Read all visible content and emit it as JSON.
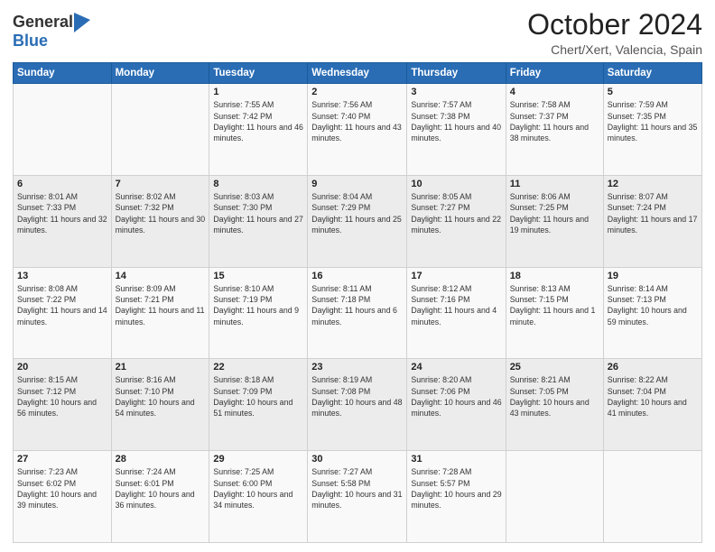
{
  "logo": {
    "general": "General",
    "blue": "Blue"
  },
  "header": {
    "month": "October 2024",
    "location": "Chert/Xert, Valencia, Spain"
  },
  "weekdays": [
    "Sunday",
    "Monday",
    "Tuesday",
    "Wednesday",
    "Thursday",
    "Friday",
    "Saturday"
  ],
  "weeks": [
    [
      {
        "day": "",
        "info": ""
      },
      {
        "day": "",
        "info": ""
      },
      {
        "day": "1",
        "info": "Sunrise: 7:55 AM\nSunset: 7:42 PM\nDaylight: 11 hours and 46 minutes."
      },
      {
        "day": "2",
        "info": "Sunrise: 7:56 AM\nSunset: 7:40 PM\nDaylight: 11 hours and 43 minutes."
      },
      {
        "day": "3",
        "info": "Sunrise: 7:57 AM\nSunset: 7:38 PM\nDaylight: 11 hours and 40 minutes."
      },
      {
        "day": "4",
        "info": "Sunrise: 7:58 AM\nSunset: 7:37 PM\nDaylight: 11 hours and 38 minutes."
      },
      {
        "day": "5",
        "info": "Sunrise: 7:59 AM\nSunset: 7:35 PM\nDaylight: 11 hours and 35 minutes."
      }
    ],
    [
      {
        "day": "6",
        "info": "Sunrise: 8:01 AM\nSunset: 7:33 PM\nDaylight: 11 hours and 32 minutes."
      },
      {
        "day": "7",
        "info": "Sunrise: 8:02 AM\nSunset: 7:32 PM\nDaylight: 11 hours and 30 minutes."
      },
      {
        "day": "8",
        "info": "Sunrise: 8:03 AM\nSunset: 7:30 PM\nDaylight: 11 hours and 27 minutes."
      },
      {
        "day": "9",
        "info": "Sunrise: 8:04 AM\nSunset: 7:29 PM\nDaylight: 11 hours and 25 minutes."
      },
      {
        "day": "10",
        "info": "Sunrise: 8:05 AM\nSunset: 7:27 PM\nDaylight: 11 hours and 22 minutes."
      },
      {
        "day": "11",
        "info": "Sunrise: 8:06 AM\nSunset: 7:25 PM\nDaylight: 11 hours and 19 minutes."
      },
      {
        "day": "12",
        "info": "Sunrise: 8:07 AM\nSunset: 7:24 PM\nDaylight: 11 hours and 17 minutes."
      }
    ],
    [
      {
        "day": "13",
        "info": "Sunrise: 8:08 AM\nSunset: 7:22 PM\nDaylight: 11 hours and 14 minutes."
      },
      {
        "day": "14",
        "info": "Sunrise: 8:09 AM\nSunset: 7:21 PM\nDaylight: 11 hours and 11 minutes."
      },
      {
        "day": "15",
        "info": "Sunrise: 8:10 AM\nSunset: 7:19 PM\nDaylight: 11 hours and 9 minutes."
      },
      {
        "day": "16",
        "info": "Sunrise: 8:11 AM\nSunset: 7:18 PM\nDaylight: 11 hours and 6 minutes."
      },
      {
        "day": "17",
        "info": "Sunrise: 8:12 AM\nSunset: 7:16 PM\nDaylight: 11 hours and 4 minutes."
      },
      {
        "day": "18",
        "info": "Sunrise: 8:13 AM\nSunset: 7:15 PM\nDaylight: 11 hours and 1 minute."
      },
      {
        "day": "19",
        "info": "Sunrise: 8:14 AM\nSunset: 7:13 PM\nDaylight: 10 hours and 59 minutes."
      }
    ],
    [
      {
        "day": "20",
        "info": "Sunrise: 8:15 AM\nSunset: 7:12 PM\nDaylight: 10 hours and 56 minutes."
      },
      {
        "day": "21",
        "info": "Sunrise: 8:16 AM\nSunset: 7:10 PM\nDaylight: 10 hours and 54 minutes."
      },
      {
        "day": "22",
        "info": "Sunrise: 8:18 AM\nSunset: 7:09 PM\nDaylight: 10 hours and 51 minutes."
      },
      {
        "day": "23",
        "info": "Sunrise: 8:19 AM\nSunset: 7:08 PM\nDaylight: 10 hours and 48 minutes."
      },
      {
        "day": "24",
        "info": "Sunrise: 8:20 AM\nSunset: 7:06 PM\nDaylight: 10 hours and 46 minutes."
      },
      {
        "day": "25",
        "info": "Sunrise: 8:21 AM\nSunset: 7:05 PM\nDaylight: 10 hours and 43 minutes."
      },
      {
        "day": "26",
        "info": "Sunrise: 8:22 AM\nSunset: 7:04 PM\nDaylight: 10 hours and 41 minutes."
      }
    ],
    [
      {
        "day": "27",
        "info": "Sunrise: 7:23 AM\nSunset: 6:02 PM\nDaylight: 10 hours and 39 minutes."
      },
      {
        "day": "28",
        "info": "Sunrise: 7:24 AM\nSunset: 6:01 PM\nDaylight: 10 hours and 36 minutes."
      },
      {
        "day": "29",
        "info": "Sunrise: 7:25 AM\nSunset: 6:00 PM\nDaylight: 10 hours and 34 minutes."
      },
      {
        "day": "30",
        "info": "Sunrise: 7:27 AM\nSunset: 5:58 PM\nDaylight: 10 hours and 31 minutes."
      },
      {
        "day": "31",
        "info": "Sunrise: 7:28 AM\nSunset: 5:57 PM\nDaylight: 10 hours and 29 minutes."
      },
      {
        "day": "",
        "info": ""
      },
      {
        "day": "",
        "info": ""
      }
    ]
  ]
}
